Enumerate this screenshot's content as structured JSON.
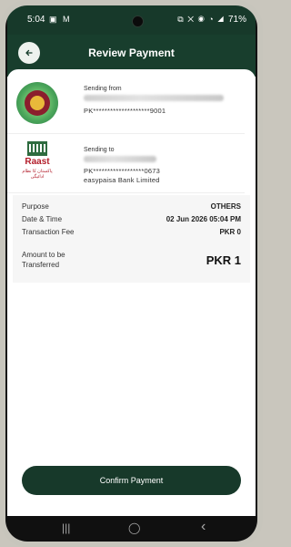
{
  "status_bar": {
    "time": "5:04",
    "left_icons": "▣ M",
    "right_icons": "⧉ ✕ ◉ ◔ ◢",
    "battery": "71%"
  },
  "header": {
    "title": "Review Payment"
  },
  "sender": {
    "label": "Sending from",
    "account_number": "PK********************9001"
  },
  "receiver": {
    "label": "Sending to",
    "account_number": "PK******************0673",
    "bank": "easypaisa Bank Limited",
    "logo_text": "Raast",
    "logo_subtext": "پاکستان کا نظام ادائیگی"
  },
  "details": {
    "purpose_label": "Purpose",
    "purpose_value": "OTHERS",
    "datetime_label": "Date & Time",
    "datetime_value": "02 Jun 2026 05:04 PM",
    "fee_label": "Transaction Fee",
    "fee_value": "PKR 0",
    "amount_label": "Amount to be Transferred",
    "amount_value": "PKR 1"
  },
  "confirm_button": {
    "label": "Confirm Payment"
  },
  "nav_bar": {
    "recents": "|||",
    "home": "◯",
    "back": "‹"
  }
}
